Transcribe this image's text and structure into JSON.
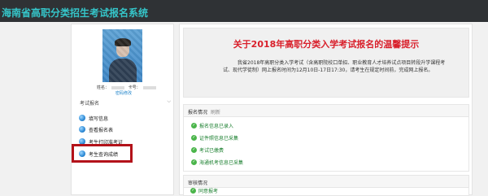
{
  "app": {
    "title": "海南省高职分类招生考试报名系统"
  },
  "profile": {
    "name_label": "姓名：",
    "id_label": "卡号：",
    "change_password": "密码修改"
  },
  "menu": {
    "section": "考试报名",
    "items": [
      {
        "label": "填写信息",
        "icon": "globe-icon"
      },
      {
        "label": "查看报名表",
        "icon": "globe-icon"
      },
      {
        "label": "考生打印准考证",
        "icon": "globe-icon"
      },
      {
        "label": "考生查询成绩",
        "icon": "globe-icon"
      }
    ]
  },
  "notice": {
    "title": "关于2018年高职分类入学考试报名的温馨提示",
    "body": "我省2018年高职分类入学考试（含高职院校口单招、职业教育人才培养试点项目转段升学课程考试、现代学徒制）网上报名时间为12月10日-17日17:30，请考生在规定时间前，完成网上报名。"
  },
  "status_panel": {
    "title": "报名情况",
    "subtitle": "刷新",
    "items": [
      "报名信息已录入",
      "证件照信息已采集",
      "考试已缴费",
      "海通机考信息已采集"
    ]
  },
  "review_panel": {
    "title": "审核情况",
    "items": [
      "同意报考"
    ]
  },
  "colors": {
    "topbar": "#2f3235",
    "title": "#35c5c9",
    "notice_title": "#d9202b",
    "highlight": "#b3121a",
    "status_ok": "#4ab54a"
  }
}
